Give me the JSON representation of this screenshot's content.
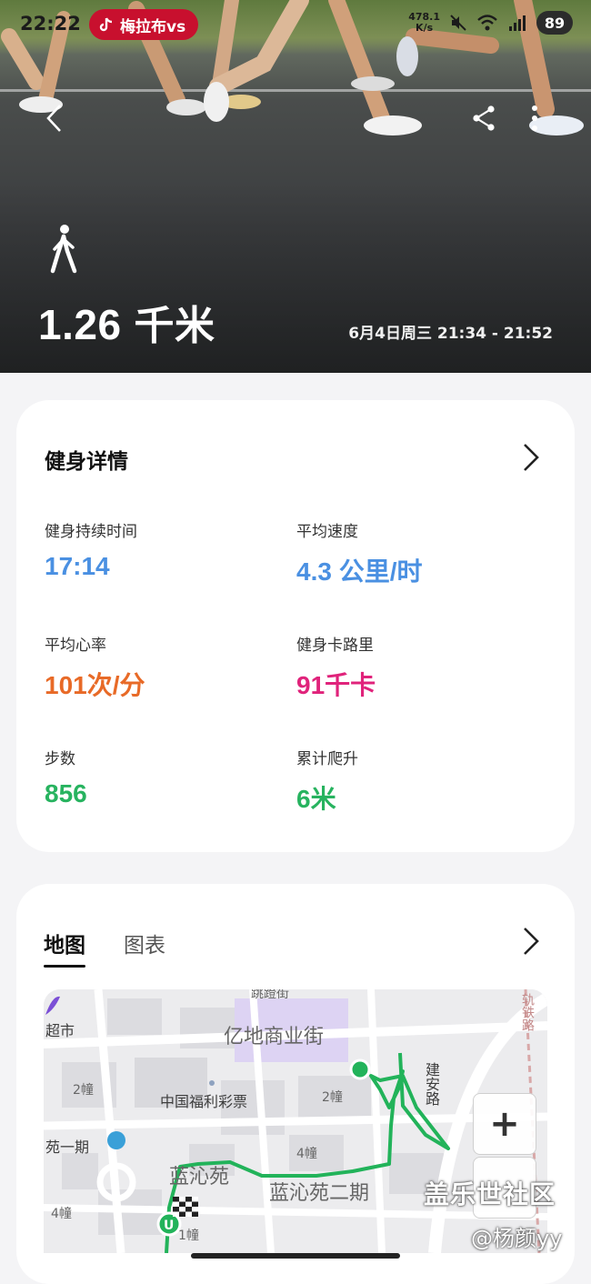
{
  "status_bar": {
    "time": "22:22",
    "notification_text": "梅拉布vs",
    "net_speed_value": "478.1",
    "net_speed_unit": "K/s",
    "battery": "89"
  },
  "hero": {
    "distance_value": "1.26",
    "distance_unit": "千米",
    "date_range": "6月4日周三 21:34 - 21:52"
  },
  "details": {
    "title": "健身详情",
    "metrics": [
      {
        "label": "健身持续时间",
        "value": "17:14",
        "color": "#4a90e2"
      },
      {
        "label": "平均速度",
        "value": "4.3 公里/时",
        "color": "#4a90e2"
      },
      {
        "label": "平均心率",
        "value": "101次/分",
        "color": "#e86a27"
      },
      {
        "label": "健身卡路里",
        "value": "91千卡",
        "color": "#e0237b"
      },
      {
        "label": "步数",
        "value": "856",
        "color": "#27b35f"
      },
      {
        "label": "累计爬升",
        "value": "6米",
        "color": "#27b35f"
      }
    ]
  },
  "map_card": {
    "tabs": [
      "地图",
      "图表"
    ],
    "active_tab": "地图",
    "labels": {
      "street_top": "跳蹬街",
      "supermarket": "超市",
      "mall": "亿地商业街",
      "road_right": "建安路",
      "rail": "轨铁路",
      "lottery": "中国福利彩票",
      "bldg_2a": "2幢",
      "bldg_2b": "2幢",
      "bldg_4a": "4幢",
      "bldg_4b": "4幢",
      "bldg_1": "1幢",
      "yuan1": "苑一期",
      "lanqin": "蓝沁苑",
      "lanqin2": "蓝沁苑二期"
    },
    "zoom_in": "+",
    "route_color": "#22b35a"
  },
  "watermark": {
    "line1": "盖乐世社区",
    "line2": "@杨颜yy"
  }
}
